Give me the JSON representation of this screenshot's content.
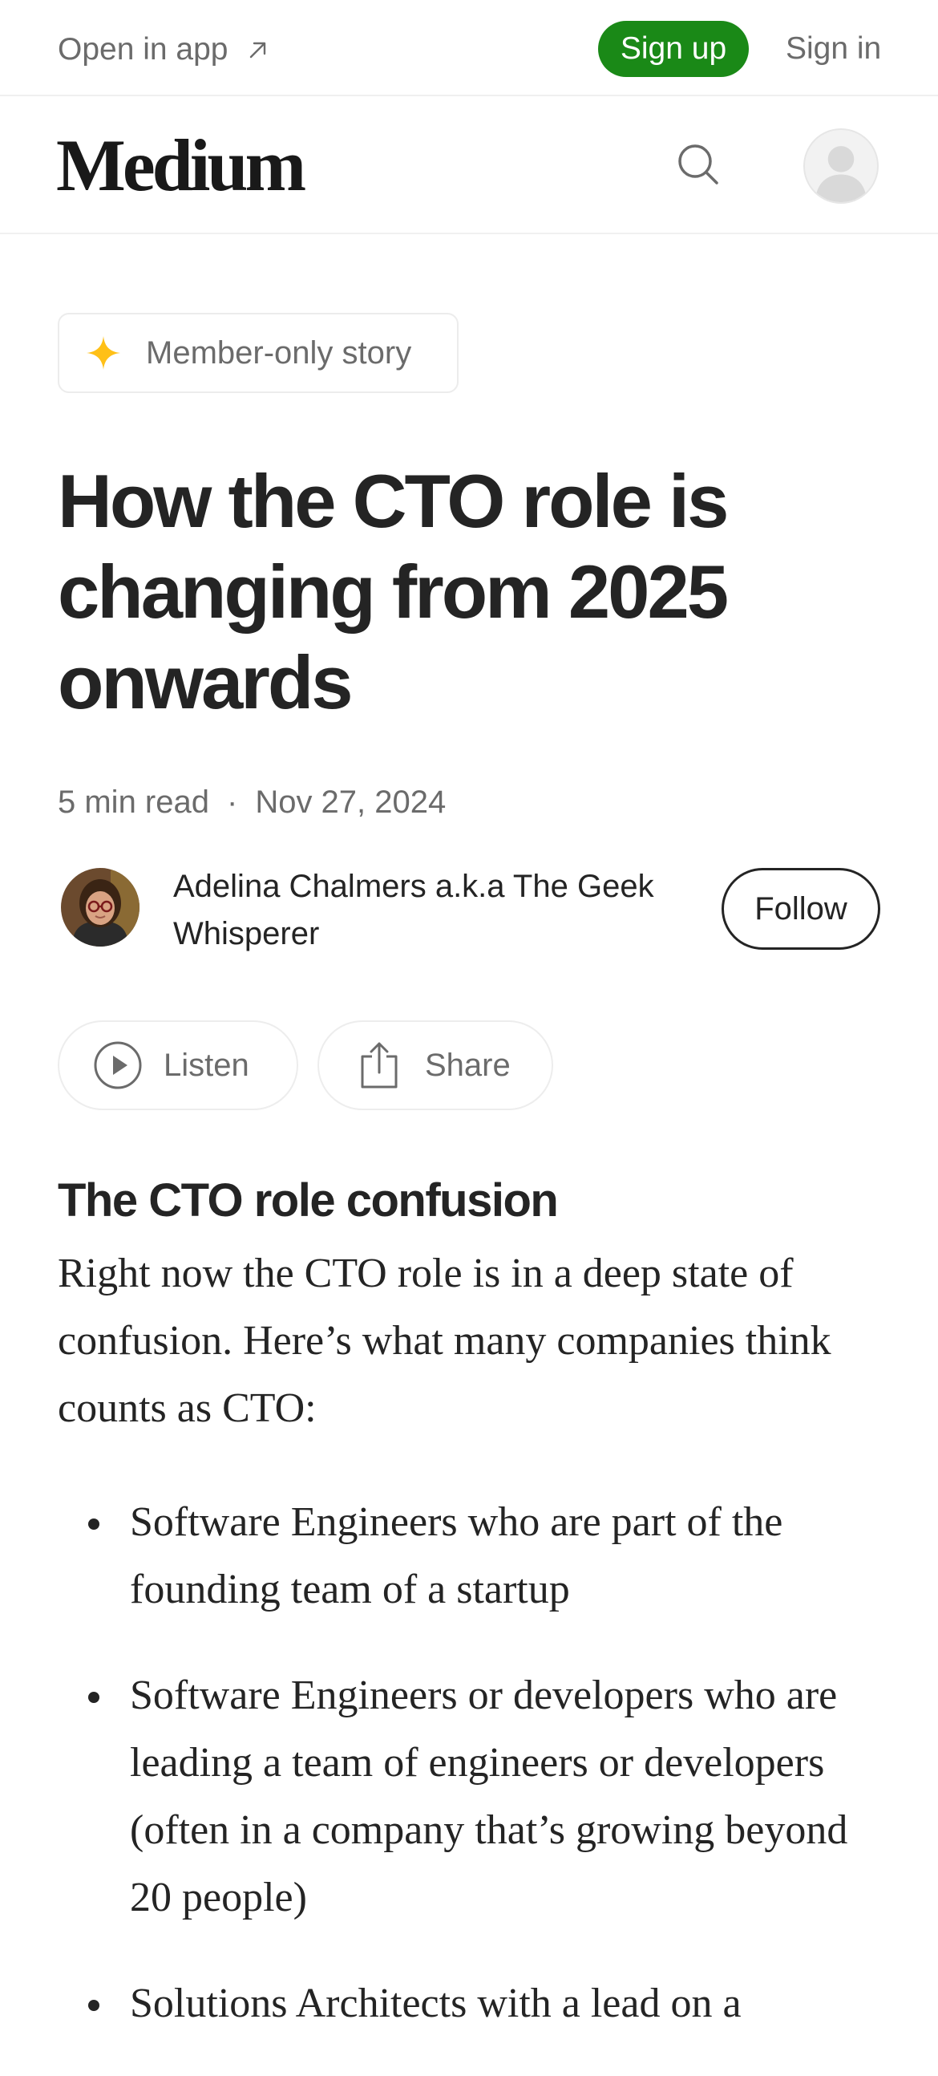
{
  "topbar": {
    "open_in_app": "Open in app",
    "sign_up": "Sign up",
    "sign_in": "Sign in",
    "signup_color": "#1a8917"
  },
  "header": {
    "logo": "Medium",
    "search_icon": "search-icon",
    "avatar_icon": "user-avatar-placeholder"
  },
  "article": {
    "badge": {
      "icon": "star-sparkle-icon",
      "icon_color": "#ffc017",
      "label": "Member-only story"
    },
    "title": "How the CTO role is changing from 2025 onwards",
    "read_time": "5 min read",
    "separator": "·",
    "date": "Nov 27, 2024",
    "author": {
      "name": "Adelina Chalmers a.k.a The Geek Whisperer",
      "follow_label": "Follow"
    },
    "actions": {
      "listen_label": "Listen",
      "share_label": "Share"
    },
    "section_heading": "The CTO role confusion",
    "intro": "Right now the CTO role is in a deep state of confusion. Here’s what many companies think counts as CTO:",
    "bullets": [
      "Software Engineers who are part of the founding team of a startup",
      "Software Engineers or developers who are leading a team of engineers or developers (often in a company that’s growing beyond 20 people)",
      "Solutions Architects with a lead on a"
    ]
  }
}
